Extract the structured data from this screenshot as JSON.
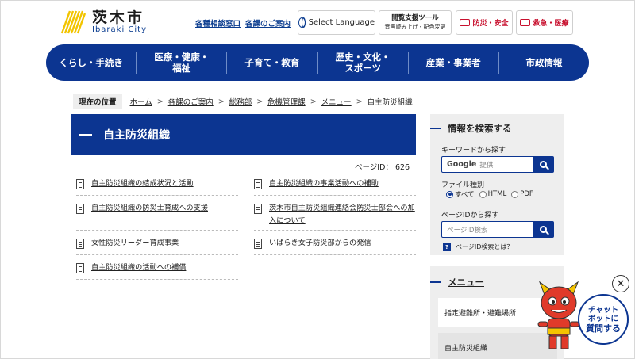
{
  "header": {
    "logo_jp": "茨木市",
    "logo_en": "Ibaraki City",
    "link_consult": "各種相談窓口",
    "link_guide": "各課のご案内",
    "lang_label": "Select Language",
    "tool_label": "閲覧支援ツール",
    "tool_sub": "音声読み上げ・配色変更",
    "disaster_label": "防災・安全",
    "emergency_label": "救急・医療",
    "accent_color": "#0c3591",
    "alert_color": "#c8102e"
  },
  "nav": {
    "items": [
      {
        "label": "くらし・手続き"
      },
      {
        "label": "医療・健康・福祉"
      },
      {
        "label": "子育て・教育"
      },
      {
        "label": "歴史・文化・スポーツ"
      },
      {
        "label": "産業・事業者"
      },
      {
        "label": "市政情報"
      }
    ]
  },
  "breadcrumb": {
    "here_label": "現在の位置",
    "items": [
      "ホーム",
      "各課のご案内",
      "総務部",
      "危機管理課",
      "メニュー",
      "自主防災組織"
    ],
    "separator": ">"
  },
  "main": {
    "title": "自主防災組織",
    "page_id": "ページID： 626",
    "links": [
      {
        "label": "自主防災組織の結成状況と活動"
      },
      {
        "label": "自主防災組織の事業活動への補助"
      },
      {
        "label": "自主防災組織の防災士育成への支援"
      },
      {
        "label": "茨木市自主防災組織連絡会防災士部会への加入について"
      },
      {
        "label": "女性防災リーダー育成事業"
      },
      {
        "label": "いばらき女子防災部からの発信"
      },
      {
        "label": "自主防災組織の活動への補償"
      }
    ]
  },
  "sidebar": {
    "search_heading": "情報を検索する",
    "keyword_label": "キーワードから探す",
    "google_label": "Google",
    "google_sub": "提供",
    "filetype_label": "ファイル種別",
    "filetype_options": [
      "すべて",
      "HTML",
      "PDF"
    ],
    "filetype_selected": "すべて",
    "pageid_label": "ページIDから探す",
    "pageid_placeholder": "ページID検索",
    "help_q": "?",
    "help_link": "ページID検索とは？",
    "menu_heading": "メニュー",
    "menu_items": [
      "指定避難所・避難場所",
      "自主防災組織"
    ],
    "menu_active": "自主防災組織"
  },
  "chatbot": {
    "line1": "チャット",
    "line2": "ボットに",
    "line3": "質問する",
    "close_symbol": "✕"
  }
}
